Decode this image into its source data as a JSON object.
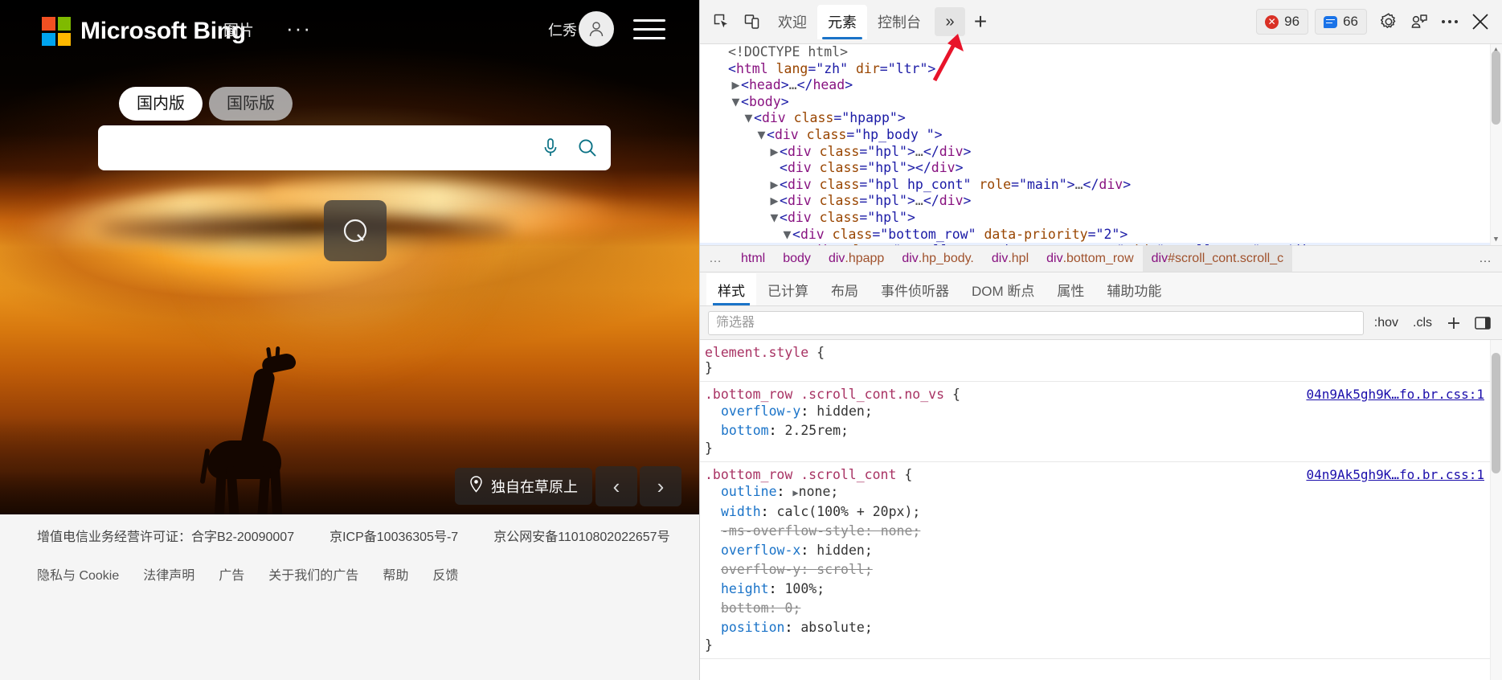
{
  "bing": {
    "brand": "Microsoft Bing",
    "nav": {
      "images": "图片",
      "more": "···"
    },
    "account": {
      "name": "仁秀",
      "avatar_icon": "user-avatar-icon"
    },
    "hamburger_icon": "hamburger-menu-icon",
    "version_tabs": [
      {
        "label": "国内版",
        "active": true
      },
      {
        "label": "国际版",
        "active": false
      }
    ],
    "search": {
      "value": "",
      "placeholder": "",
      "mic_icon": "microphone-icon",
      "search_icon": "search-magnifier-icon"
    },
    "logo_badge_icon": "bing-logo-icon",
    "image_caption": "独自在草原上",
    "caption_pin_icon": "location-pin-icon",
    "prev_label": "‹",
    "next_label": "›",
    "footer_line1": [
      "增值电信业务经营许可证：合字B2-20090007",
      "京ICP备10036305号-7",
      "京公网安备11010802022657号"
    ],
    "footer_line2": [
      "隐私与 Cookie",
      "法律声明",
      "广告",
      "关于我们的广告",
      "帮助",
      "反馈"
    ]
  },
  "devtools": {
    "toolbar": {
      "inspect_icon": "inspect-element-icon",
      "device_icon": "device-toolbar-icon",
      "tabs": [
        {
          "label": "欢迎",
          "active": false
        },
        {
          "label": "元素",
          "active": true
        },
        {
          "label": "控制台",
          "active": false
        }
      ],
      "more_tabs_label": "»",
      "add_tab_label": "+",
      "error_count": "96",
      "message_count": "66",
      "error_icon": "error-circle-icon",
      "message_icon": "message-bubble-icon",
      "settings_icon": "gear-icon",
      "feedback_icon": "feedback-icon",
      "more_icon": "more-options-icon",
      "close_icon": "close-icon"
    },
    "dom_tree": [
      {
        "indent": 0,
        "twisty": "none",
        "parts": [
          {
            "t": "txt",
            "s": "<!DOCTYPE html>"
          }
        ]
      },
      {
        "indent": 0,
        "twisty": "none",
        "parts": [
          {
            "t": "ang",
            "s": "<"
          },
          {
            "t": "tag",
            "s": "html"
          },
          {
            "t": "attr",
            "s": " lang"
          },
          {
            "t": "ang",
            "s": "="
          },
          {
            "t": "val",
            "s": "\"zh\""
          },
          {
            "t": "attr",
            "s": " dir"
          },
          {
            "t": "ang",
            "s": "="
          },
          {
            "t": "val",
            "s": "\"ltr\""
          },
          {
            "t": "ang",
            "s": ">"
          }
        ]
      },
      {
        "indent": 1,
        "twisty": "right",
        "parts": [
          {
            "t": "ang",
            "s": "<"
          },
          {
            "t": "tag",
            "s": "head"
          },
          {
            "t": "ang",
            "s": ">"
          },
          {
            "t": "txt",
            "s": "…"
          },
          {
            "t": "ang",
            "s": "</"
          },
          {
            "t": "tag",
            "s": "head"
          },
          {
            "t": "ang",
            "s": ">"
          }
        ]
      },
      {
        "indent": 1,
        "twisty": "down",
        "parts": [
          {
            "t": "ang",
            "s": "<"
          },
          {
            "t": "tag",
            "s": "body"
          },
          {
            "t": "ang",
            "s": ">"
          }
        ]
      },
      {
        "indent": 2,
        "twisty": "down",
        "parts": [
          {
            "t": "ang",
            "s": "<"
          },
          {
            "t": "tag",
            "s": "div"
          },
          {
            "t": "attr",
            "s": " class"
          },
          {
            "t": "ang",
            "s": "="
          },
          {
            "t": "val",
            "s": "\"hpapp\""
          },
          {
            "t": "ang",
            "s": ">"
          }
        ]
      },
      {
        "indent": 3,
        "twisty": "down",
        "parts": [
          {
            "t": "ang",
            "s": "<"
          },
          {
            "t": "tag",
            "s": "div"
          },
          {
            "t": "attr",
            "s": " class"
          },
          {
            "t": "ang",
            "s": "="
          },
          {
            "t": "val",
            "s": "\"hp_body  \""
          },
          {
            "t": "ang",
            "s": ">"
          }
        ]
      },
      {
        "indent": 4,
        "twisty": "right",
        "parts": [
          {
            "t": "ang",
            "s": "<"
          },
          {
            "t": "tag",
            "s": "div"
          },
          {
            "t": "attr",
            "s": " class"
          },
          {
            "t": "ang",
            "s": "="
          },
          {
            "t": "val",
            "s": "\"hpl\""
          },
          {
            "t": "ang",
            "s": ">"
          },
          {
            "t": "txt",
            "s": "…"
          },
          {
            "t": "ang",
            "s": "</"
          },
          {
            "t": "tag",
            "s": "div"
          },
          {
            "t": "ang",
            "s": ">"
          }
        ]
      },
      {
        "indent": 4,
        "twisty": "none",
        "parts": [
          {
            "t": "ang",
            "s": "<"
          },
          {
            "t": "tag",
            "s": "div"
          },
          {
            "t": "attr",
            "s": " class"
          },
          {
            "t": "ang",
            "s": "="
          },
          {
            "t": "val",
            "s": "\"hpl\""
          },
          {
            "t": "ang",
            "s": ">"
          },
          {
            "t": "ang",
            "s": "</"
          },
          {
            "t": "tag",
            "s": "div"
          },
          {
            "t": "ang",
            "s": ">"
          }
        ]
      },
      {
        "indent": 4,
        "twisty": "right",
        "parts": [
          {
            "t": "ang",
            "s": "<"
          },
          {
            "t": "tag",
            "s": "div"
          },
          {
            "t": "attr",
            "s": " class"
          },
          {
            "t": "ang",
            "s": "="
          },
          {
            "t": "val",
            "s": "\"hpl hp_cont\""
          },
          {
            "t": "attr",
            "s": " role"
          },
          {
            "t": "ang",
            "s": "="
          },
          {
            "t": "val",
            "s": "\"main\""
          },
          {
            "t": "ang",
            "s": ">"
          },
          {
            "t": "txt",
            "s": "…"
          },
          {
            "t": "ang",
            "s": "</"
          },
          {
            "t": "tag",
            "s": "div"
          },
          {
            "t": "ang",
            "s": ">"
          }
        ]
      },
      {
        "indent": 4,
        "twisty": "right",
        "parts": [
          {
            "t": "ang",
            "s": "<"
          },
          {
            "t": "tag",
            "s": "div"
          },
          {
            "t": "attr",
            "s": " class"
          },
          {
            "t": "ang",
            "s": "="
          },
          {
            "t": "val",
            "s": "\"hpl\""
          },
          {
            "t": "ang",
            "s": ">"
          },
          {
            "t": "txt",
            "s": "…"
          },
          {
            "t": "ang",
            "s": "</"
          },
          {
            "t": "tag",
            "s": "div"
          },
          {
            "t": "ang",
            "s": ">"
          }
        ]
      },
      {
        "indent": 4,
        "twisty": "down",
        "parts": [
          {
            "t": "ang",
            "s": "<"
          },
          {
            "t": "tag",
            "s": "div"
          },
          {
            "t": "attr",
            "s": " class"
          },
          {
            "t": "ang",
            "s": "="
          },
          {
            "t": "val",
            "s": "\"hpl\""
          },
          {
            "t": "ang",
            "s": ">"
          }
        ]
      },
      {
        "indent": 5,
        "twisty": "down",
        "parts": [
          {
            "t": "ang",
            "s": "<"
          },
          {
            "t": "tag",
            "s": "div"
          },
          {
            "t": "attr",
            "s": " class"
          },
          {
            "t": "ang",
            "s": "="
          },
          {
            "t": "val",
            "s": "\"bottom_row\""
          },
          {
            "t": "attr",
            "s": " data-priority"
          },
          {
            "t": "ang",
            "s": "="
          },
          {
            "t": "val",
            "s": "\"2\""
          },
          {
            "t": "ang",
            "s": ">"
          }
        ]
      },
      {
        "indent": 6,
        "twisty": "right",
        "selected": true,
        "parts": [
          {
            "t": "ang",
            "s": "<"
          },
          {
            "t": "tag",
            "s": "div"
          },
          {
            "t": "attr",
            "s": " class"
          },
          {
            "t": "ang",
            "s": "="
          },
          {
            "t": "val",
            "s": "\"scroll_cont show_none no_vs\""
          },
          {
            "t": "attr",
            "s": " id"
          },
          {
            "t": "ang",
            "s": "="
          },
          {
            "t": "val",
            "s": "\"scroll_cont\""
          },
          {
            "t": "ang",
            "s": ">"
          },
          {
            "t": "txt",
            "s": "…"
          },
          {
            "t": "ang",
            "s": "</div>"
          }
        ]
      }
    ],
    "breadcrumb": {
      "leading": "…",
      "items": [
        {
          "tag": "html",
          "cls": ""
        },
        {
          "tag": "body",
          "cls": ""
        },
        {
          "tag": "div",
          "cls": ".hpapp"
        },
        {
          "tag": "div",
          "cls": ".hp_body."
        },
        {
          "tag": "div",
          "cls": ".hpl"
        },
        {
          "tag": "div",
          "cls": ".bottom_row"
        },
        {
          "tag": "div",
          "cls": "#scroll_cont.scroll_c",
          "selected": true
        }
      ],
      "trailing": "…"
    },
    "style_tabs": [
      {
        "label": "样式",
        "active": true
      },
      {
        "label": "已计算",
        "active": false
      },
      {
        "label": "布局",
        "active": false
      },
      {
        "label": "事件侦听器",
        "active": false
      },
      {
        "label": "DOM 断点",
        "active": false
      },
      {
        "label": "属性",
        "active": false
      },
      {
        "label": "辅助功能",
        "active": false
      }
    ],
    "filter": {
      "placeholder": "筛选器",
      "value": "",
      "hov_label": ":hov",
      "cls_label": ".cls",
      "new_rule_icon": "plus-icon",
      "toggle_sidebar_icon": "toggle-element-state-icon"
    },
    "css_rules": [
      {
        "selector": "element.style",
        "source": "",
        "declarations": []
      },
      {
        "selector": ".bottom_row .scroll_cont.no_vs",
        "source": "04n9Ak5gh9K…fo.br.css:1",
        "declarations": [
          {
            "prop": "overflow-y",
            "value": "hidden",
            "disabled": false,
            "expandable": false
          },
          {
            "prop": "bottom",
            "value": "2.25rem",
            "disabled": false,
            "expandable": false
          }
        ]
      },
      {
        "selector": ".bottom_row .scroll_cont",
        "source": "04n9Ak5gh9K…fo.br.css:1",
        "declarations": [
          {
            "prop": "outline",
            "value": "none",
            "disabled": false,
            "expandable": true
          },
          {
            "prop": "width",
            "value": "calc(100% + 20px)",
            "disabled": false,
            "expandable": false
          },
          {
            "prop": "-ms-overflow-style",
            "value": "none",
            "disabled": true,
            "expandable": false
          },
          {
            "prop": "overflow-x",
            "value": "hidden",
            "disabled": false,
            "expandable": false
          },
          {
            "prop": "overflow-y",
            "value": "scroll",
            "disabled": true,
            "expandable": false
          },
          {
            "prop": "height",
            "value": "100%",
            "disabled": false,
            "expandable": false
          },
          {
            "prop": "bottom",
            "value": "0",
            "disabled": true,
            "expandable": false
          },
          {
            "prop": "position",
            "value": "absolute",
            "disabled": false,
            "expandable": false
          }
        ]
      }
    ]
  }
}
